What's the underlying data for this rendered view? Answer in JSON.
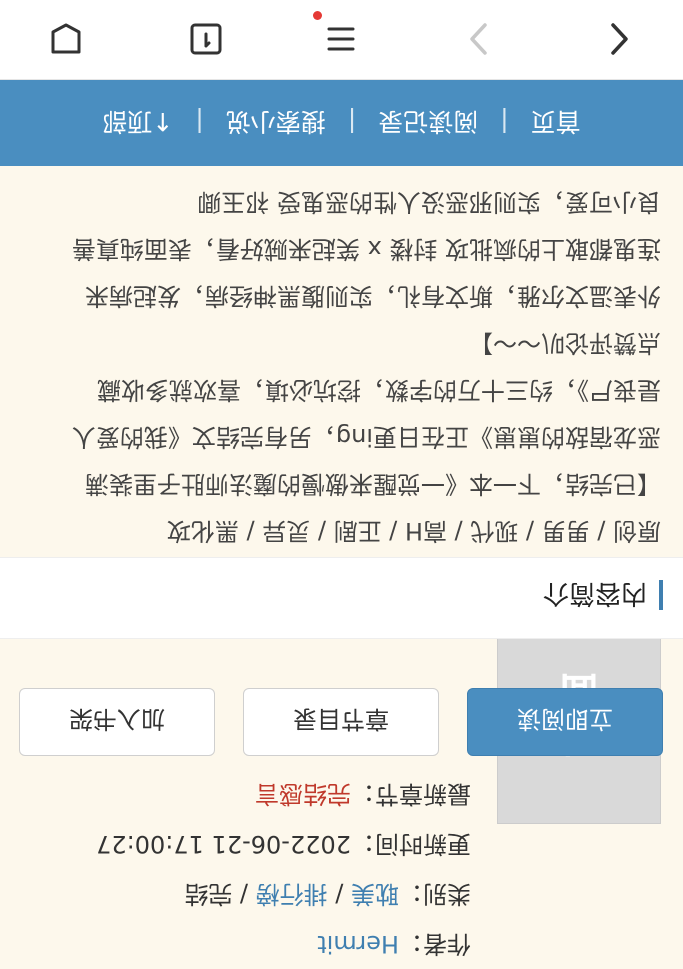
{
  "book": {
    "cover_text": "无封面",
    "author_label": "作者：",
    "author": "Hermit",
    "category_label": "类别：",
    "category": "耽美",
    "ranking_link": "排行榜",
    "status": "完结",
    "updated_label": "更新时间：",
    "updated": "2022-06-21 17:00:27",
    "latest_label": "最新章节：",
    "latest": "完结感言"
  },
  "actions": {
    "read_now": "立即阅读",
    "toc": "章节目录",
    "add_shelf": "加入书架"
  },
  "intro": {
    "title": "内容简介",
    "lines": [
      "原创 / 男男 / 现代 / 高H / 正剧 / 灵异 / 黑化攻",
      "【已完结，下一本《一觉醒来傲慢的魔法师肚子里装满",
      "恶龙宿敌的崽崽》正在日更ing，另有完结文《我的爱人",
      "是丧尸》，约三十万的字数，挖坑必填，喜欢就多收藏",
      "点赞评论叭～～】",
      "外表温文尔雅，斯文有礼，实则腹黑神经病，发起病来",
      "连鬼都敢上的疯批攻 封楼 x 笑起来贼好看，表面纯真善",
      "良小可爱，实则邪恶没人性的恶鬼受 祁玉卿"
    ]
  },
  "nav": {
    "home": "首页",
    "history": "阅读记录",
    "search": "搜索小说",
    "top": "↑顶部"
  }
}
